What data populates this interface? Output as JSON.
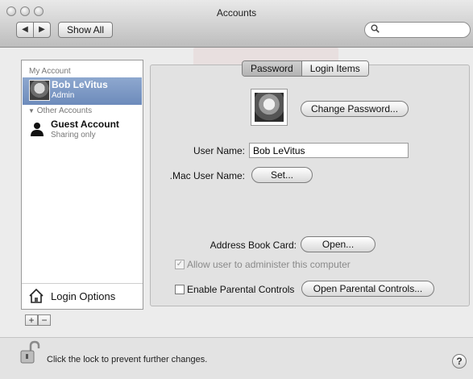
{
  "window": {
    "title": "Accounts"
  },
  "toolbar": {
    "back_symbol": "◀",
    "forward_symbol": "▶",
    "show_all_label": "Show All"
  },
  "search": {
    "placeholder": "",
    "value": ""
  },
  "sidebar": {
    "my_account_header": "My Account",
    "selected_user": {
      "name": "Bob LeVitus",
      "role": "Admin"
    },
    "other_accounts_header": "Other Accounts",
    "guest": {
      "name": "Guest Account",
      "subtitle": "Sharing only"
    },
    "login_options_label": "Login Options"
  },
  "sidebar_controls": {
    "add_label": "+",
    "remove_label": "−"
  },
  "tabs": [
    {
      "label": "Password",
      "selected": true
    },
    {
      "label": "Login Items",
      "selected": false
    }
  ],
  "password_pane": {
    "change_password_label": "Change Password...",
    "user_name_label": "User Name:",
    "user_name_value": "Bob LeVitus",
    "mac_user_name_label": ".Mac User Name:",
    "set_button_label": "Set...",
    "address_book_label": "Address Book Card:",
    "open_button_label": "Open...",
    "allow_admin_label": "Allow user to administer this computer",
    "allow_admin_checked": true,
    "allow_admin_enabled": false,
    "parental_controls_label": "Enable Parental Controls",
    "parental_controls_checked": false,
    "open_parental_controls_label": "Open Parental Controls..."
  },
  "footer": {
    "lock_text": "Click the lock to prevent further changes.",
    "help_label": "?"
  },
  "icons": {
    "traffic_lights": "window-control-icons",
    "search": "magnifier-icon",
    "lock": "unlocked-padlock-icon",
    "house": "house-icon",
    "guest": "person-silhouette-icon"
  },
  "colors": {
    "selection": "#7b98c6",
    "window": "#ececec"
  }
}
